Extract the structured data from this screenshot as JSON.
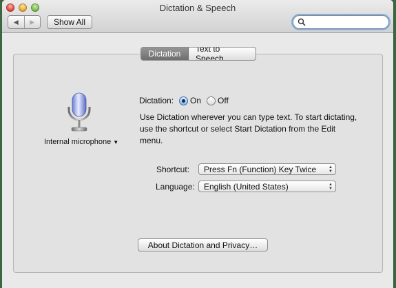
{
  "window": {
    "title": "Dictation & Speech",
    "nav_back": "◀",
    "nav_forward": "▶",
    "show_all_label": "Show All",
    "search": {
      "value": "",
      "placeholder": ""
    }
  },
  "tabs": [
    {
      "label": "Dictation",
      "selected": true
    },
    {
      "label": "Text to Speech",
      "selected": false
    }
  ],
  "microphone": {
    "label": "Internal microphone",
    "icon": "microphone-icon"
  },
  "dictation": {
    "label": "Dictation:",
    "on_label": "On",
    "off_label": "Off",
    "selected": "On",
    "description": "Use Dictation wherever you can type text. To start dictating, use the shortcut or select Start Dictation from the Edit menu."
  },
  "shortcut": {
    "label": "Shortcut:",
    "value": "Press Fn (Function) Key Twice"
  },
  "language": {
    "label": "Language:",
    "value": "English (United States)"
  },
  "about_button_label": "About Dictation and Privacy…",
  "colors": {
    "active_tab": "#7f7f7f",
    "radio_accent": "#3d6fb5",
    "focus_ring": "#7fb1e6"
  }
}
